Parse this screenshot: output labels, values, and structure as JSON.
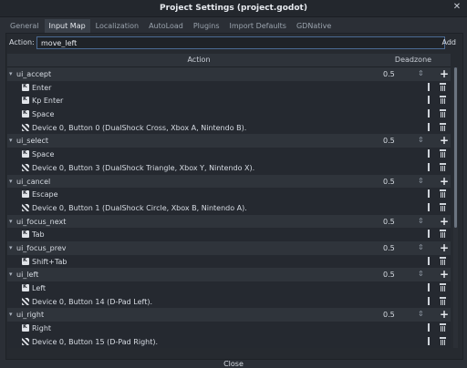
{
  "window": {
    "title": "Project Settings (project.godot)",
    "close_icon": "close-icon"
  },
  "tabs": [
    {
      "label": "General",
      "active": false
    },
    {
      "label": "Input Map",
      "active": true
    },
    {
      "label": "Localization",
      "active": false
    },
    {
      "label": "AutoLoad",
      "active": false
    },
    {
      "label": "Plugins",
      "active": false
    },
    {
      "label": "Import Defaults",
      "active": false
    },
    {
      "label": "GDNative",
      "active": false
    }
  ],
  "action_bar": {
    "label": "Action:",
    "value": "move_left",
    "add_label": "Add"
  },
  "table": {
    "col_action": "Action",
    "col_deadzone": "Deadzone"
  },
  "actions": [
    {
      "name": "ui_accept",
      "deadzone": "0.5",
      "events": [
        {
          "type": "key",
          "text": "Enter"
        },
        {
          "type": "key",
          "text": "Kp Enter"
        },
        {
          "type": "key",
          "text": "Space"
        },
        {
          "type": "joypad",
          "text": "Device 0, Button 0 (DualShock Cross, Xbox A, Nintendo B)."
        }
      ]
    },
    {
      "name": "ui_select",
      "deadzone": "0.5",
      "events": [
        {
          "type": "key",
          "text": "Space"
        },
        {
          "type": "joypad",
          "text": "Device 0, Button 3 (DualShock Triangle, Xbox Y, Nintendo X)."
        }
      ]
    },
    {
      "name": "ui_cancel",
      "deadzone": "0.5",
      "events": [
        {
          "type": "key",
          "text": "Escape"
        },
        {
          "type": "joypad",
          "text": "Device 0, Button 1 (DualShock Circle, Xbox B, Nintendo A)."
        }
      ]
    },
    {
      "name": "ui_focus_next",
      "deadzone": "0.5",
      "events": [
        {
          "type": "key",
          "text": "Tab"
        }
      ]
    },
    {
      "name": "ui_focus_prev",
      "deadzone": "0.5",
      "events": [
        {
          "type": "key",
          "text": "Shift+Tab"
        }
      ]
    },
    {
      "name": "ui_left",
      "deadzone": "0.5",
      "events": [
        {
          "type": "key",
          "text": "Left"
        },
        {
          "type": "joypad",
          "text": "Device 0, Button 14 (D-Pad Left)."
        }
      ]
    },
    {
      "name": "ui_right",
      "deadzone": "0.5",
      "events": [
        {
          "type": "key",
          "text": "Right"
        },
        {
          "type": "joypad",
          "text": "Device 0, Button 15 (D-Pad Right)."
        }
      ]
    }
  ],
  "footer": {
    "close_label": "Close"
  }
}
